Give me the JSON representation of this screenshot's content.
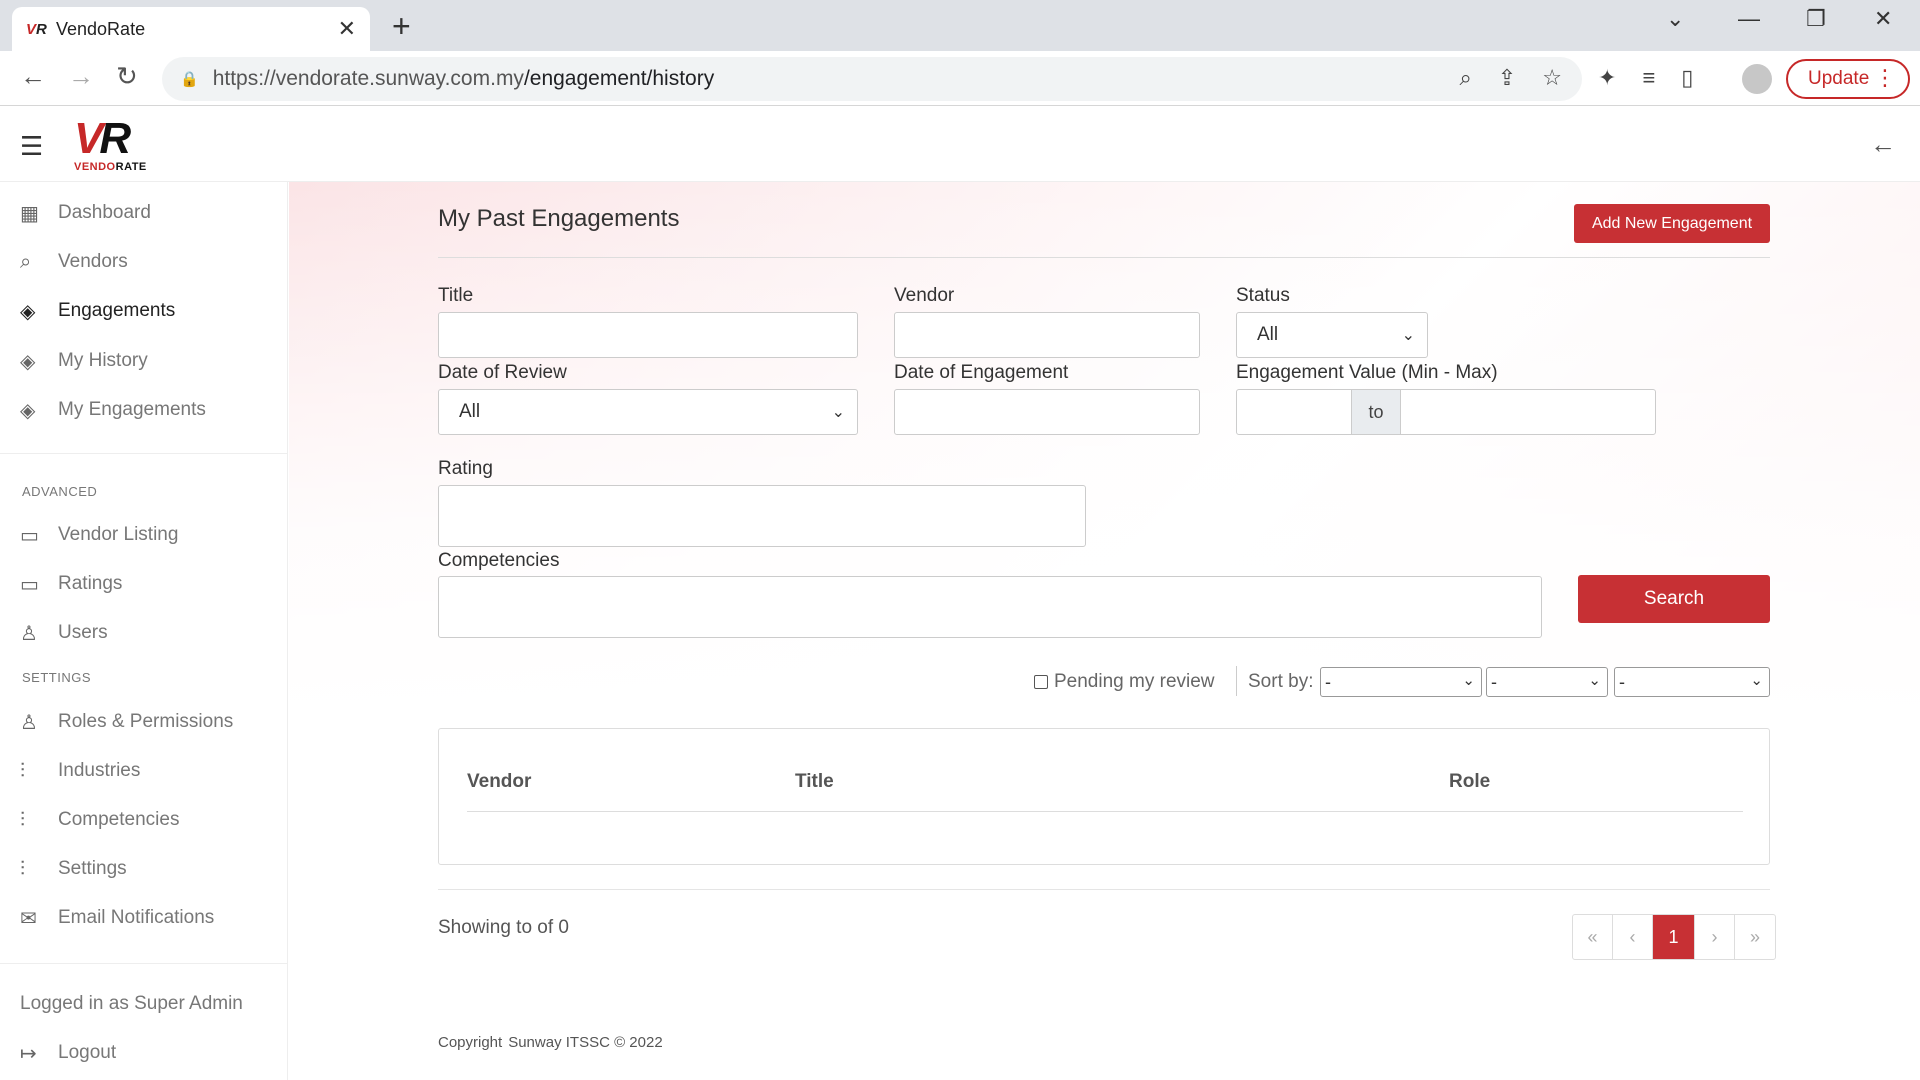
{
  "browser": {
    "tab_title": "VendoRate",
    "url_host": "https://vendorate.sunway.com.my",
    "url_path": "/engagement/history",
    "update_label": "Update"
  },
  "logo": {
    "vr": "VR",
    "brand": "VENDORATE"
  },
  "sidebar": {
    "items": [
      {
        "label": "Dashboard",
        "icon": "grid-icon"
      },
      {
        "label": "Vendors",
        "icon": "search-icon"
      },
      {
        "label": "Engagements",
        "icon": "layers-icon"
      },
      {
        "label": "My History",
        "icon": "layers-icon"
      },
      {
        "label": "My Engagements",
        "icon": "layers-icon"
      }
    ],
    "advanced_heading": "ADVANCED",
    "advanced_items": [
      {
        "label": "Vendor Listing",
        "icon": "message-square-icon"
      },
      {
        "label": "Ratings",
        "icon": "message-square-icon"
      },
      {
        "label": "Users",
        "icon": "user-icon"
      }
    ],
    "settings_heading": "SETTINGS",
    "settings_items": [
      {
        "label": "Roles & Permissions",
        "icon": "user-check-icon"
      },
      {
        "label": "Industries",
        "icon": "sliders-icon"
      },
      {
        "label": "Competencies",
        "icon": "sliders-icon"
      },
      {
        "label": "Settings",
        "icon": "sliders-icon"
      },
      {
        "label": "Email Notifications",
        "icon": "mail-icon"
      }
    ],
    "logged_in": "Logged in as Super Admin",
    "logout": "Logout"
  },
  "main": {
    "title": "My Past Engagements",
    "add_button": "Add New Engagement",
    "filters": {
      "title_label": "Title",
      "vendor_label": "Vendor",
      "status_label": "Status",
      "status_value": "All",
      "date_review_label": "Date of Review",
      "date_review_value": "All",
      "date_engagement_label": "Date of Engagement",
      "value_label": "Engagement Value (Min - Max)",
      "to_label": "to",
      "rating_label": "Rating",
      "competencies_label": "Competencies",
      "search_button": "Search"
    },
    "pending_label": "Pending my review",
    "sort_label": "Sort by:",
    "sort_values": [
      "-",
      "-",
      "-"
    ],
    "table": {
      "headers": [
        "Vendor",
        "Title",
        "Role"
      ]
    },
    "showing": "Showing to of 0",
    "pager": {
      "first": "«",
      "prev": "‹",
      "current": "1",
      "next": "›",
      "last": "»"
    },
    "footer": {
      "copyright": "Copyright",
      "org": "Sunway ITSSC © 2022"
    }
  }
}
